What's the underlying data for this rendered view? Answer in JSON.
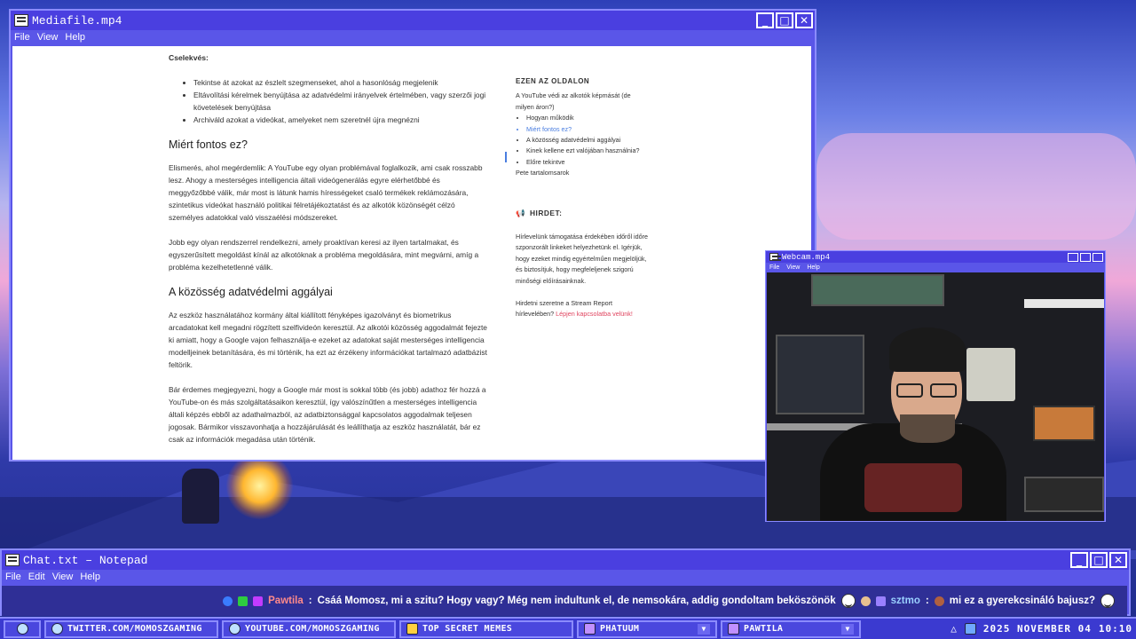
{
  "media_window": {
    "title": "Mediafile.mp4",
    "menu": [
      "File",
      "View",
      "Help"
    ],
    "controls": {
      "minimize": "_",
      "maximize": "□",
      "close": "✕"
    }
  },
  "article": {
    "action_label": "Cselekvés:",
    "actions": [
      "Tekintse át azokat az észlelt szegmenseket, ahol a hasonlóság megjelenik",
      "Eltávolítási kérelmek benyújtása az adatvédelmi irányelvek értelmében, vagy szerzői jogi követelések benyújtása",
      "Archiváld azokat a videókat, amelyeket nem szeretnél újra megnézni"
    ],
    "heading1": "Miért fontos ez?",
    "para1": "Elismerés, ahol megérdemlik: A YouTube egy olyan problémával foglalkozik, ami csak rosszabb lesz. Ahogy a mesterséges intelligencia általi videógenerálás egyre elérhetőbbé és meggyőzőbbé válik, már most is látunk hamis hírességeket csaló termékek reklámozására, szintetikus videókat használó politikai félretájékoztatást és az alkotók közönségét célzó személyes adatokkal való visszaélési módszereket.",
    "para2": "Jobb egy olyan rendszerrel rendelkezni, amely proaktívan keresi az ilyen tartalmakat, és egyszerűsített megoldást kínál az alkotóknak a probléma megoldására, mint megvárni, amíg a probléma kezelhetetlenné válik.",
    "heading2": "A közösség adatvédelmi aggályai",
    "para3": "Az eszköz használatához kormány által kiállított fényképes igazolványt és biometrikus arcadatokat kell megadni rögzített szelfivideón keresztül. Az alkotói közösség aggodalmát fejezte ki amiatt, hogy a Google vajon felhasználja-e ezeket az adatokat saját mesterséges intelligencia modelljeinek betanítására, és mi történik, ha ezt az érzékeny információkat tartalmazó adatbázist feltörik.",
    "para4": "Bár érdemes megjegyezni, hogy a Google már most is sokkal több (és jobb) adathoz fér hozzá a YouTube-on és más szolgáltatásaikon keresztül, így valószínűtlen a mesterséges intelligencia általi képzés ebből az adathalmazból, az adatbiztonsággal kapcsolatos aggodalmak teljesen jogosak. Bármikor visszavonhatja a hozzájárulását és leállíthatja az eszköz használatát, bár ez csak az információk megadása után történik."
  },
  "toc": {
    "header": "EZEN AZ OLDALON",
    "intro": "A YouTube védi az alkotók képmását (de milyen áron?)",
    "items": [
      "Hogyan működik",
      "Miért fontos ez?",
      "A közösség adatvédelmi aggályai",
      "Kinek kellene ezt valójában használnia?",
      "Előre tekintve"
    ],
    "footer": "Pete tartalomsarok"
  },
  "ad": {
    "header": "HIRDET:",
    "para1": "Hírlevelünk támogatása érdekében időről időre szponzorált linkeket helyezhetünk el. Igérjük, hogy ezeket mindig egyértelműen megjelöljük, és biztosítjuk, hogy megfeleljenek szigorú minőségi előírásainknak.",
    "para2_prefix": "Hirdetni szeretne a Stream Report hírlevelében?",
    "para2_link": "Lépjen kapcsolatba velünk!"
  },
  "webcam_window": {
    "title": "Webcam.mp4",
    "menu": [
      "File",
      "View",
      "Help"
    ]
  },
  "chat_window": {
    "title": "Chat.txt – Notepad",
    "menu": [
      "File",
      "Edit",
      "View",
      "Help"
    ],
    "message1_user": "Pawtila",
    "message1_text": "Csáá Momosz, mi a szitu? Hogy vagy?  Még nem indultunk el, de nemsokára, addig gondoltam beköszönök",
    "message2_user": "sztmo",
    "message2_text": "mi ez a gyerekcsináló bajusz?"
  },
  "taskbar": {
    "items": [
      "TWITTER.COM/MOMOSZGAMING",
      "YOUTUBE.COM/MOMOSZGAMING",
      "TOP SECRET MEMES",
      "PHATUUM",
      "PAWTILA"
    ],
    "date": "2025 NOVEMBER 04",
    "time": "10:10"
  },
  "colors": {
    "window": "#5a56e8",
    "titlebar": "#4a3fe0",
    "link": "#e0445f",
    "toc_active": "#4a7ee0"
  }
}
